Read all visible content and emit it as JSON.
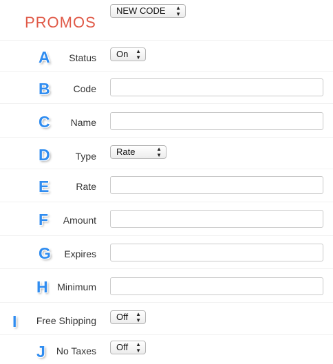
{
  "header": {
    "title": "PROMOS",
    "code_select": "NEW CODE"
  },
  "fields": [
    {
      "letter": "A",
      "label": "Status",
      "kind": "select",
      "value": "On"
    },
    {
      "letter": "B",
      "label": "Code",
      "kind": "input",
      "value": ""
    },
    {
      "letter": "C",
      "label": "Name",
      "kind": "input",
      "value": ""
    },
    {
      "letter": "D",
      "label": "Type",
      "kind": "select",
      "value": "Rate"
    },
    {
      "letter": "E",
      "label": "Rate",
      "kind": "input",
      "value": ""
    },
    {
      "letter": "F",
      "label": "Amount",
      "kind": "input",
      "value": ""
    },
    {
      "letter": "G",
      "label": "Expires",
      "kind": "input",
      "value": ""
    },
    {
      "letter": "H",
      "label": "Minimum",
      "kind": "input",
      "value": ""
    },
    {
      "letter": "I",
      "label": "Free Shipping",
      "kind": "select",
      "value": "Off"
    },
    {
      "letter": "J",
      "label": "No Taxes",
      "kind": "select",
      "value": "Off"
    }
  ],
  "colors": {
    "title": "#e05a48",
    "badge": "#2f8cf0"
  },
  "icons": {
    "select_arrows": "updown-arrows-icon"
  }
}
